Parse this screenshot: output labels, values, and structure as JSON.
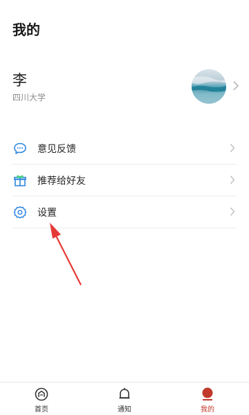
{
  "header": {
    "title": "我的"
  },
  "profile": {
    "name": "李",
    "organization": "四川大学"
  },
  "menu": {
    "items": [
      {
        "label": "意见反馈",
        "icon": "chat-bubble-icon"
      },
      {
        "label": "推荐给好友",
        "icon": "gift-icon"
      },
      {
        "label": "设置",
        "icon": "gear-icon"
      }
    ]
  },
  "tabbar": {
    "tabs": [
      {
        "label": "首页",
        "icon": "home-icon",
        "active": false
      },
      {
        "label": "通知",
        "icon": "bell-icon",
        "active": false
      },
      {
        "label": "我的",
        "icon": "profile-icon",
        "active": true
      }
    ]
  },
  "colors": {
    "accent": "#c0392b",
    "icon_blue": "#2e86de",
    "annotation": "#e53935"
  }
}
